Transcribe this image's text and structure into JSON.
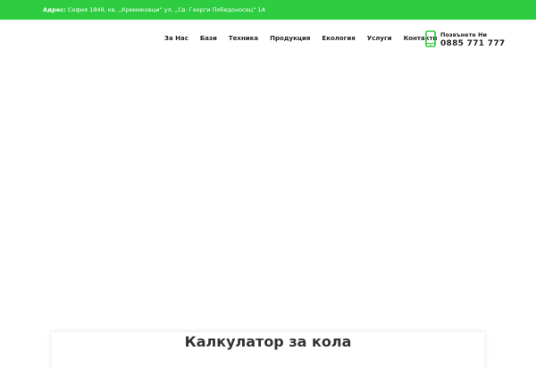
{
  "topbar": {
    "address_label": "Адрес:",
    "address_value": " София 1849, кв. „Кремиковци“ ул. „Св. Георги Победоносец“ 1А",
    "background": "#2ecc40"
  },
  "nav": {
    "items": [
      "За Нас",
      "Бази",
      "Техника",
      "Продукция",
      "Екология",
      "Услуги",
      "Контакти"
    ]
  },
  "contact": {
    "icon": "smartphone-icon",
    "label": "Позвънете Ни",
    "phone": "0885 771 777",
    "accent": "#2ecc40"
  },
  "calculator": {
    "title": "Калкулатор за кола"
  }
}
